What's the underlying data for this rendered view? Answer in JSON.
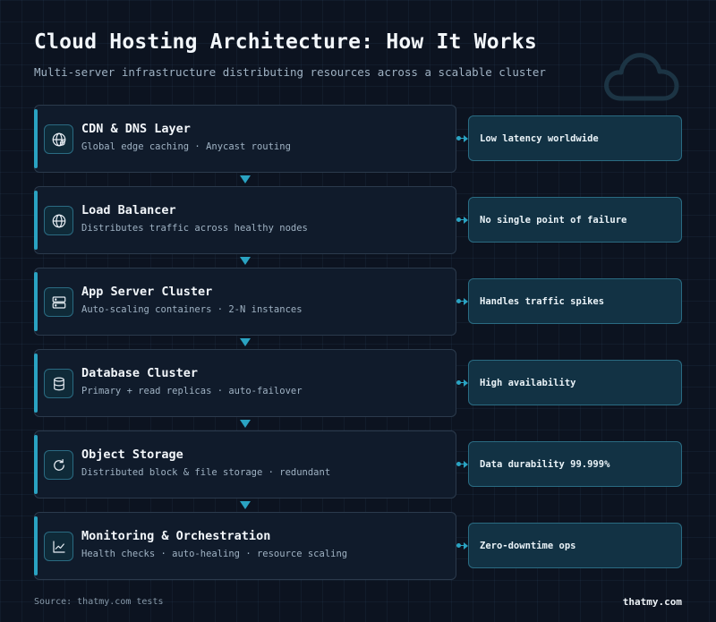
{
  "header": {
    "title": "Cloud Hosting Architecture: How It Works",
    "subtitle": "Multi-server infrastructure distributing resources across a scalable cluster"
  },
  "layers": [
    {
      "title": "CDN & DNS Layer",
      "description": "Global edge caching · Anycast routing",
      "icon": "globe-network-icon",
      "benefit": "Low latency worldwide"
    },
    {
      "title": "Load Balancer",
      "description": "Distributes traffic across healthy nodes",
      "icon": "globe-icon",
      "benefit": "No single point of failure"
    },
    {
      "title": "App Server Cluster",
      "description": "Auto-scaling containers · 2-N instances",
      "icon": "server-icon",
      "benefit": "Handles traffic spikes"
    },
    {
      "title": "Database Cluster",
      "description": "Primary + read replicas · auto-failover",
      "icon": "database-icon",
      "benefit": "High availability"
    },
    {
      "title": "Object Storage",
      "description": "Distributed block & file storage · redundant",
      "icon": "refresh-icon",
      "benefit": "Data durability 99.999%"
    },
    {
      "title": "Monitoring & Orchestration",
      "description": "Health checks · auto-healing · resource scaling",
      "icon": "chart-line-icon",
      "benefit": "Zero-downtime ops"
    }
  ],
  "footer": {
    "source": "Source: thatmy.com tests",
    "brand": "thatmy.com"
  },
  "colors": {
    "background": "#0c1320",
    "accent": "#2aa3c2",
    "card": "#101b2b",
    "benefit_card": "#123244"
  }
}
